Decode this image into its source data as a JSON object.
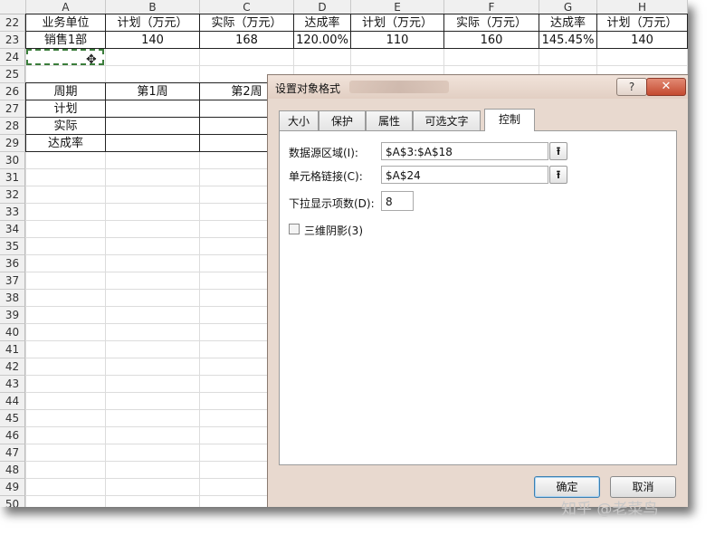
{
  "sheet": {
    "columns": [
      "A",
      "B",
      "C",
      "D",
      "E",
      "F",
      "G",
      "H"
    ],
    "rows": [
      "22",
      "23",
      "24",
      "25",
      "26",
      "27",
      "28",
      "29",
      "30",
      "31",
      "32",
      "33",
      "34",
      "35",
      "36",
      "37",
      "38",
      "39",
      "40",
      "41",
      "42",
      "43",
      "44",
      "45",
      "46",
      "47",
      "48",
      "49",
      "50"
    ],
    "row22": [
      "业务单位",
      "计划（万元）",
      "实际（万元）",
      "达成率",
      "计划（万元）",
      "实际（万元）",
      "达成率",
      "计划（万元）"
    ],
    "row23": [
      "销售1部",
      "140",
      "168",
      "120.00%",
      "110",
      "160",
      "145.45%",
      "140"
    ],
    "row26": [
      "周期",
      "第1周",
      "第2周"
    ],
    "row27_a": "计划",
    "row28_a": "实际",
    "row29_a": "达成率",
    "cursor_glyph": "✥"
  },
  "dialog": {
    "title": "设置对象格式",
    "help": "?",
    "close": "✕",
    "tabs": [
      "大小",
      "保护",
      "属性",
      "可选文字",
      "控制"
    ],
    "active_tab": "控制",
    "input_range_label": "数据源区域(I):",
    "input_range_value": "$A$3:$A$18",
    "cell_link_label": "单元格链接(C):",
    "cell_link_value": "$A$24",
    "dropdown_lines_label": "下拉显示项数(D):",
    "dropdown_lines_value": "8",
    "shading_label": "三维阴影(3)",
    "ref_button_glyph": "⭱",
    "ok": "确定",
    "cancel": "取消"
  },
  "watermark": "知乎 @老菜鸟"
}
